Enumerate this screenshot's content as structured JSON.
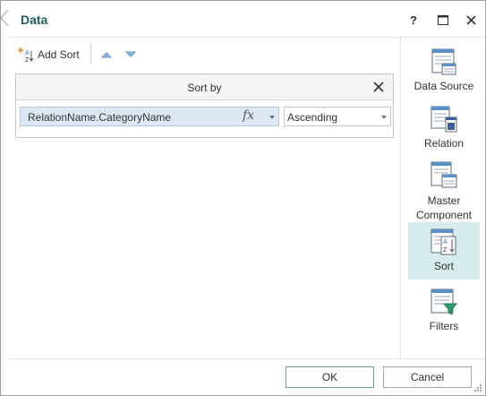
{
  "dialog": {
    "title": "Data",
    "help_label": "?",
    "colors": {
      "accent": "#1f5f5f",
      "selected_bg": "#d6ecec",
      "field_bg": "#dde8f5"
    }
  },
  "toolbar": {
    "add_sort_label": "Add Sort",
    "icons": [
      "add-sort-icon",
      "move-up-icon",
      "move-down-icon"
    ]
  },
  "sort_panel": {
    "header": "Sort by",
    "rows": [
      {
        "field": "RelationName.CategoryName",
        "function_label": "fx",
        "order": "Ascending"
      }
    ]
  },
  "sidebar": {
    "items": [
      {
        "label": "Data Source",
        "icon": "data-source-icon",
        "active": false
      },
      {
        "label": "Relation",
        "icon": "relation-icon",
        "active": false
      },
      {
        "label": "Master Component",
        "icon": "master-component-icon",
        "active": false
      },
      {
        "label": "Sort",
        "icon": "sort-icon",
        "active": true
      },
      {
        "label": "Filters",
        "icon": "filters-icon",
        "active": false
      }
    ]
  },
  "footer": {
    "ok_label": "OK",
    "cancel_label": "Cancel"
  }
}
